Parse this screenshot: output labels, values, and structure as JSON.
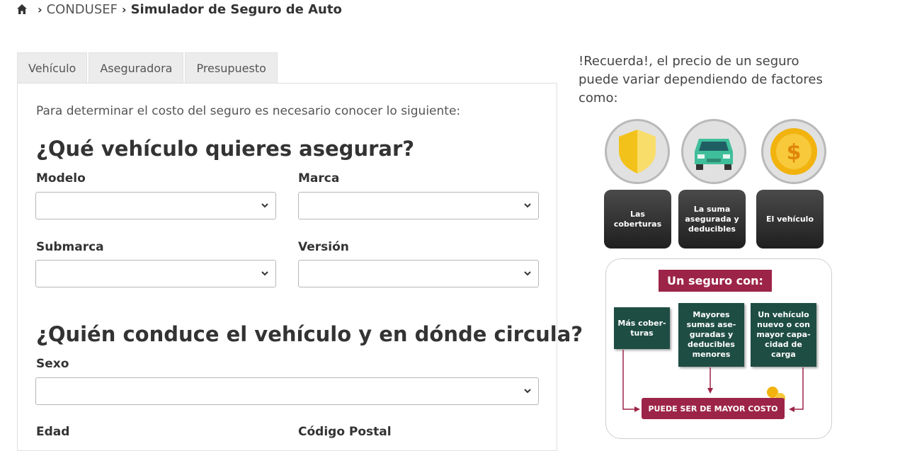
{
  "breadcrumb": {
    "link": "CONDUSEF",
    "current": "Simulador de Seguro de Auto"
  },
  "tabs": [
    {
      "label": "Vehículo"
    },
    {
      "label": "Aseguradora"
    },
    {
      "label": "Presupuesto"
    }
  ],
  "form": {
    "intro": "Para determinar el costo del seguro es necesario conocer lo siguiente:",
    "section1_title": "¿Qué vehículo quieres asegurar?",
    "section2_title": "¿Quién conduce el vehículo y en dónde circula?",
    "fields": {
      "modelo": {
        "label": "Modelo",
        "value": ""
      },
      "marca": {
        "label": "Marca",
        "value": ""
      },
      "submarca": {
        "label": "Submarca",
        "value": ""
      },
      "version": {
        "label": "Versión",
        "value": ""
      },
      "sexo": {
        "label": "Sexo",
        "value": ""
      },
      "edad": {
        "label": "Edad"
      },
      "codigo_postal": {
        "label": "Código Postal"
      }
    }
  },
  "sidebar": {
    "reminder": "!Recuerda!, el precio de un seguro puede variar dependiendo de factores como:",
    "factors": [
      {
        "icon": "shield-icon",
        "label": "Las coberturas"
      },
      {
        "icon": "car-icon",
        "label": "La suma asegurada y deducibles"
      },
      {
        "icon": "dollar-coin-icon",
        "label": "El vehículo"
      }
    ],
    "infographic": {
      "title": "Un seguro con:",
      "items": [
        "Más cober-turas",
        "Mayores sumas ase-guradas y deducibles menores",
        "Un vehículo nuevo o con mayor capa-cidad de carga"
      ],
      "result": "PUEDE SER DE MAYOR COSTO"
    }
  },
  "colors": {
    "brand": "#9d2449",
    "green": "#1e4d43",
    "tab_bg": "#ececec"
  }
}
